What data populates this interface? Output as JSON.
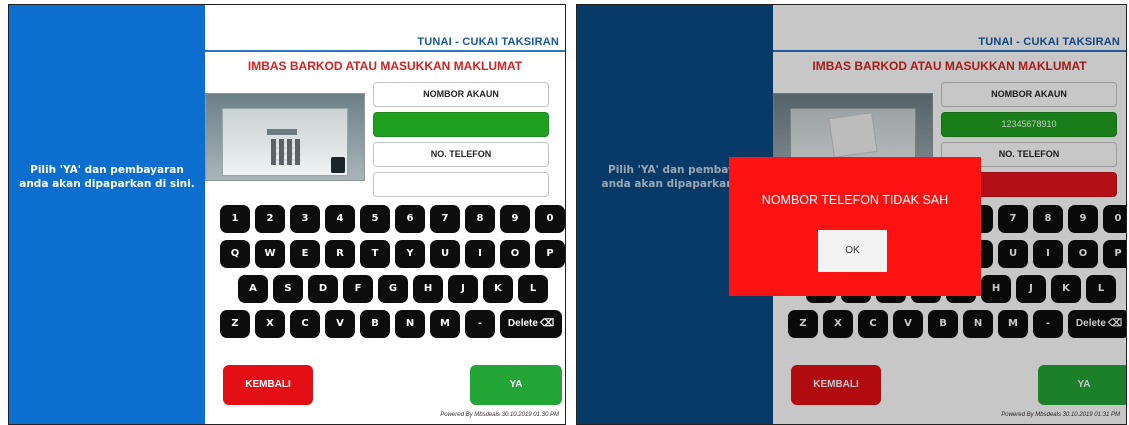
{
  "side_text_line1": "Pilih 'YA' dan pembayaran",
  "side_text_line2": "anda akan dipaparkan di sini.",
  "side_text_right_line1": "Pilih 'YA' dan pembaya",
  "side_text_right_line2": "anda akan dipaparkan di",
  "header_title": "TUNAI - CUKAI TAKSIRAN",
  "instruction": "IMBAS BARKOD ATAU MASUKKAN MAKLUMAT",
  "account_label": "NOMBOR AKAUN",
  "account_value_left": "",
  "account_value_right": "12345678910",
  "phone_label": "NO. TELEFON",
  "phone_value": "",
  "keys_row1": [
    "1",
    "2",
    "3",
    "4",
    "5",
    "6",
    "7",
    "8",
    "9",
    "0"
  ],
  "keys_row2": [
    "Q",
    "W",
    "E",
    "R",
    "T",
    "Y",
    "U",
    "I",
    "O",
    "P"
  ],
  "keys_row3": [
    "A",
    "S",
    "D",
    "F",
    "G",
    "H",
    "J",
    "K",
    "L"
  ],
  "keys_row4": [
    "Z",
    "X",
    "C",
    "V",
    "B",
    "N",
    "M",
    "-"
  ],
  "delete_label": "Delete",
  "delete_icon": "backspace-icon",
  "back_button": "KEMBALI",
  "yes_button": "YA",
  "footer_left": "Powered By Mbsdeals   30.10.2019 01:30 PM",
  "footer_right": "Powered By Mbsdeals   30.10.2019 01:31 PM",
  "modal_message": "NOMBOR TELEFON TIDAK SAH",
  "modal_ok": "OK",
  "colors": {
    "sidebar": "#0c6fcf",
    "sidebar_dim": "#0a4b84",
    "accent_red": "#e30f14",
    "accent_green": "#23a535",
    "header_blue": "#1659a8"
  }
}
